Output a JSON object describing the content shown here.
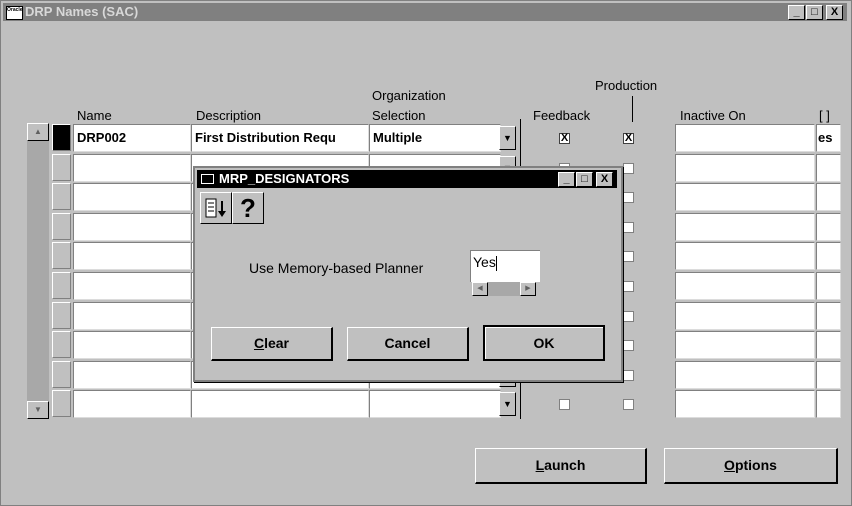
{
  "window": {
    "title": "DRP Names (SAC)",
    "app_icon_label": "Oracle",
    "minimize": "_",
    "maximize": "□",
    "close": "X"
  },
  "headers": {
    "name": "Name",
    "description": "Description",
    "org_selection_line1": "Organization",
    "org_selection_line2": "Selection",
    "production": "Production",
    "feedback": "Feedback",
    "inactive_on": "Inactive On",
    "extra": "[ ]"
  },
  "rows": [
    {
      "name": "DRP002",
      "description": "First Distribution Requ",
      "org_selection": "Multiple",
      "feedback": "X",
      "production": "X",
      "inactive_on": "",
      "extra": "es"
    },
    {
      "name": "",
      "description": "",
      "org_selection": "",
      "feedback": "",
      "production": "",
      "inactive_on": "",
      "extra": ""
    },
    {
      "name": "",
      "description": "",
      "org_selection": "",
      "feedback": "",
      "production": "",
      "inactive_on": "",
      "extra": ""
    },
    {
      "name": "",
      "description": "",
      "org_selection": "",
      "feedback": "",
      "production": "",
      "inactive_on": "",
      "extra": ""
    },
    {
      "name": "",
      "description": "",
      "org_selection": "",
      "feedback": "",
      "production": "",
      "inactive_on": "",
      "extra": ""
    },
    {
      "name": "",
      "description": "",
      "org_selection": "",
      "feedback": "",
      "production": "",
      "inactive_on": "",
      "extra": ""
    },
    {
      "name": "",
      "description": "",
      "org_selection": "",
      "feedback": "",
      "production": "",
      "inactive_on": "",
      "extra": ""
    },
    {
      "name": "",
      "description": "",
      "org_selection": "",
      "feedback": "",
      "production": "",
      "inactive_on": "",
      "extra": ""
    },
    {
      "name": "",
      "description": "",
      "org_selection": "",
      "feedback": "",
      "production": "",
      "inactive_on": "",
      "extra": ""
    },
    {
      "name": "",
      "description": "",
      "org_selection": "",
      "feedback": "",
      "production": "",
      "inactive_on": "",
      "extra": ""
    }
  ],
  "buttons": {
    "launch_prefix": "L",
    "launch_rest": "aunch",
    "options_prefix": "O",
    "options_rest": "ptions"
  },
  "dialog": {
    "title": "MRP_DESIGNATORS",
    "help_glyph": "?",
    "field_label": "Use Memory-based Planner",
    "field_value": "Yes",
    "clear_prefix": "C",
    "clear_rest": "lear",
    "cancel_label": "Cancel",
    "ok_label": "OK"
  }
}
